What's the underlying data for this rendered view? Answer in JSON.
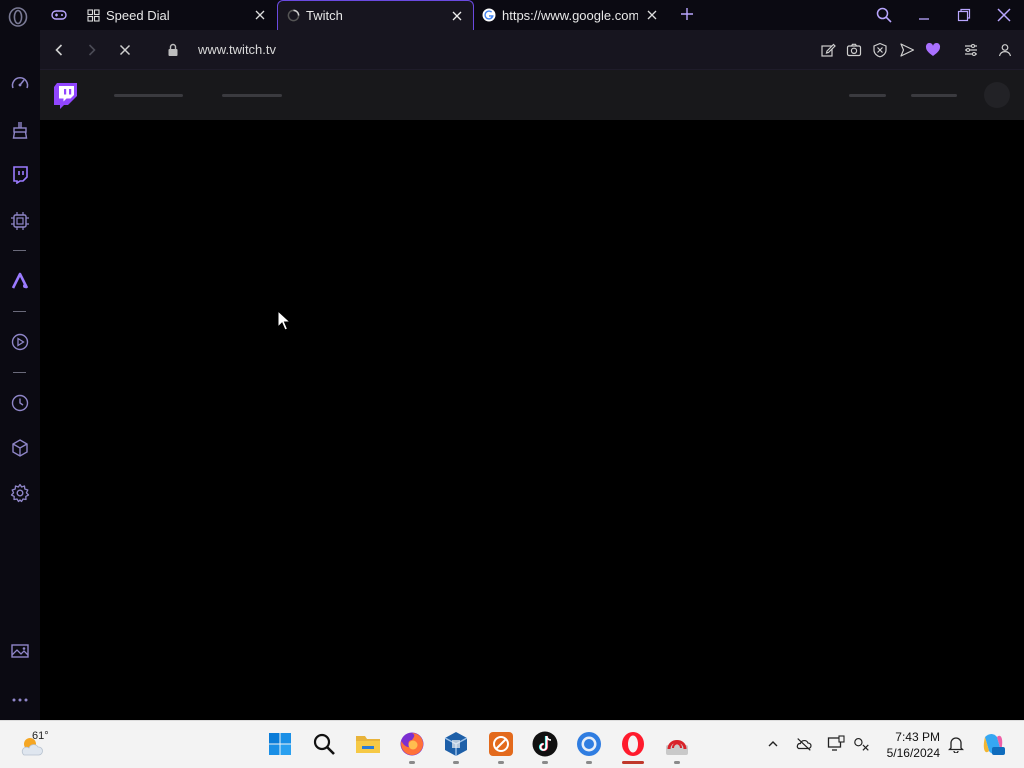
{
  "tabs": [
    {
      "title": "Speed Dial",
      "icon": "grid-icon"
    },
    {
      "title": "Twitch",
      "icon": "loading-spinner-icon",
      "active": true
    },
    {
      "title": "https://www.google.com/s",
      "icon": "google-icon"
    }
  ],
  "address_bar": {
    "url": "www.twitch.tv"
  },
  "taskbar": {
    "weather_temp": "61°",
    "clock_time": "7:43 PM",
    "clock_date": "5/16/2024"
  },
  "colors": {
    "accent": "#a970ff",
    "tab_border": "#6a4ae0",
    "twitch_purple": "#9146ff"
  }
}
